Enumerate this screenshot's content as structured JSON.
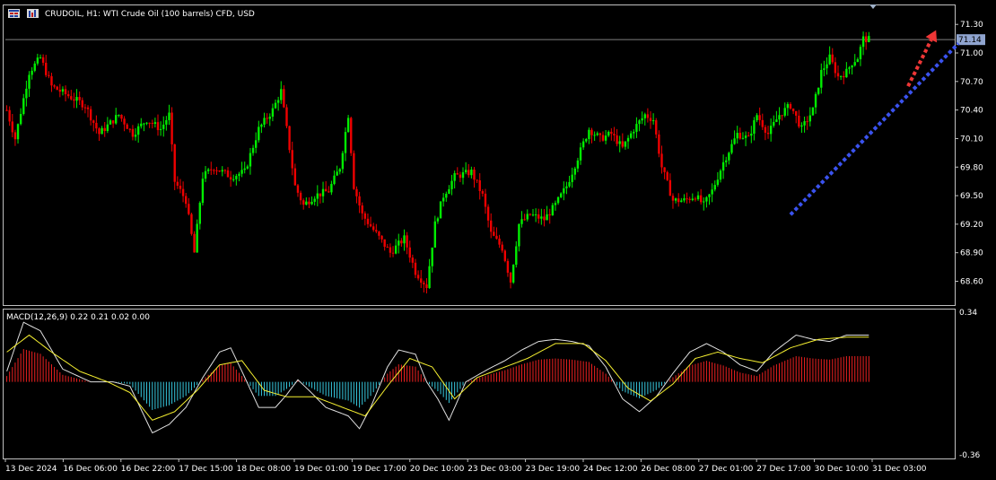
{
  "header": {
    "symbol_text": "CRUDOIL, H1:  WTI Crude Oil (100 barrels) CFD, USD"
  },
  "colors": {
    "background": "#000000",
    "frame": "#c0c0c0",
    "bull": "#00ee00",
    "bear": "#ee0000",
    "hist_pos": "#ee2020",
    "hist_neg": "#36c8de",
    "macd_line": "#e0e0e0",
    "signal_line": "#f5ef30",
    "trend_line": "#3a52ee",
    "arrow": "#ee3636",
    "bid_line": "#808080",
    "bid_tag": "#8fa4cf"
  },
  "price_axis": {
    "ticks": [
      "71.30",
      "71.00",
      "70.70",
      "70.40",
      "70.10",
      "69.80",
      "69.50",
      "69.20",
      "68.90",
      "68.60"
    ],
    "current_tag": "71.14",
    "range": [
      68.35,
      71.5
    ]
  },
  "macd_panel": {
    "label": "MACD(12,26,9) 0.22 0.21 0.02 0.00",
    "axis_top": "0.34",
    "axis_bottom": "-0.36",
    "range": [
      -0.36,
      0.34
    ]
  },
  "time_axis": {
    "labels": [
      "13 Dec 2024",
      "16 Dec 06:00",
      "16 Dec 22:00",
      "17 Dec 15:00",
      "18 Dec 08:00",
      "19 Dec 01:00",
      "19 Dec 17:00",
      "20 Dec 10:00",
      "23 Dec 03:00",
      "23 Dec 19:00",
      "24 Dec 12:00",
      "26 Dec 08:00",
      "27 Dec 01:00",
      "27 Dec 17:00",
      "30 Dec 10:00",
      "31 Dec 03:00"
    ]
  },
  "chart_data": {
    "type": "candlestick",
    "symbol": "CRUDOIL",
    "timeframe": "H1",
    "price_path": [
      [
        0,
        70.4
      ],
      [
        3,
        70.1
      ],
      [
        8,
        70.8
      ],
      [
        12,
        70.95
      ],
      [
        16,
        70.65
      ],
      [
        22,
        70.55
      ],
      [
        28,
        70.45
      ],
      [
        33,
        70.15
      ],
      [
        40,
        70.35
      ],
      [
        45,
        70.15
      ],
      [
        50,
        70.3
      ],
      [
        55,
        70.2
      ],
      [
        58,
        70.35
      ],
      [
        60,
        69.65
      ],
      [
        64,
        69.45
      ],
      [
        67,
        68.9
      ],
      [
        70,
        69.7
      ],
      [
        74,
        69.8
      ],
      [
        80,
        69.7
      ],
      [
        85,
        69.75
      ],
      [
        90,
        70.2
      ],
      [
        95,
        70.4
      ],
      [
        98,
        70.6
      ],
      [
        100,
        70.2
      ],
      [
        103,
        69.6
      ],
      [
        106,
        69.4
      ],
      [
        110,
        69.5
      ],
      [
        115,
        69.55
      ],
      [
        119,
        69.8
      ],
      [
        122,
        70.35
      ],
      [
        124,
        69.6
      ],
      [
        127,
        69.3
      ],
      [
        132,
        69.1
      ],
      [
        137,
        68.9
      ],
      [
        142,
        69.05
      ],
      [
        146,
        68.7
      ],
      [
        150,
        68.55
      ],
      [
        153,
        69.2
      ],
      [
        156,
        69.5
      ],
      [
        160,
        69.7
      ],
      [
        166,
        69.75
      ],
      [
        170,
        69.5
      ],
      [
        173,
        69.1
      ],
      [
        177,
        68.95
      ],
      [
        180,
        68.6
      ],
      [
        183,
        69.2
      ],
      [
        187,
        69.3
      ],
      [
        192,
        69.25
      ],
      [
        196,
        69.4
      ],
      [
        200,
        69.6
      ],
      [
        204,
        69.9
      ],
      [
        208,
        70.2
      ],
      [
        212,
        70.1
      ],
      [
        216,
        70.15
      ],
      [
        220,
        70.0
      ],
      [
        224,
        70.2
      ],
      [
        228,
        70.35
      ],
      [
        231,
        70.3
      ],
      [
        234,
        69.8
      ],
      [
        238,
        69.45
      ],
      [
        242,
        69.45
      ],
      [
        246,
        69.5
      ],
      [
        249,
        69.4
      ],
      [
        252,
        69.55
      ],
      [
        256,
        69.85
      ],
      [
        261,
        70.15
      ],
      [
        265,
        70.1
      ],
      [
        268,
        70.35
      ],
      [
        272,
        70.15
      ],
      [
        276,
        70.35
      ],
      [
        280,
        70.45
      ],
      [
        284,
        70.2
      ],
      [
        288,
        70.4
      ],
      [
        291,
        70.8
      ],
      [
        294,
        70.95
      ],
      [
        297,
        70.75
      ],
      [
        300,
        70.8
      ],
      [
        302,
        70.9
      ],
      [
        304,
        70.95
      ],
      [
        306,
        71.15
      ],
      [
        308,
        71.14
      ]
    ],
    "macd_path": [
      [
        0,
        0.05
      ],
      [
        6,
        0.28
      ],
      [
        12,
        0.24
      ],
      [
        20,
        0.06
      ],
      [
        30,
        0.0
      ],
      [
        38,
        0.0
      ],
      [
        44,
        -0.02
      ],
      [
        52,
        -0.24
      ],
      [
        58,
        -0.2
      ],
      [
        64,
        -0.12
      ],
      [
        70,
        0.02
      ],
      [
        76,
        0.14
      ],
      [
        80,
        0.16
      ],
      [
        84,
        0.05
      ],
      [
        90,
        -0.12
      ],
      [
        96,
        -0.12
      ],
      [
        100,
        -0.06
      ],
      [
        104,
        0.01
      ],
      [
        108,
        -0.04
      ],
      [
        114,
        -0.12
      ],
      [
        122,
        -0.16
      ],
      [
        126,
        -0.22
      ],
      [
        130,
        -0.12
      ],
      [
        136,
        0.07
      ],
      [
        140,
        0.15
      ],
      [
        146,
        0.13
      ],
      [
        150,
        0.0
      ],
      [
        154,
        -0.08
      ],
      [
        158,
        -0.18
      ],
      [
        164,
        0.0
      ],
      [
        172,
        0.06
      ],
      [
        178,
        0.1
      ],
      [
        184,
        0.15
      ],
      [
        190,
        0.19
      ],
      [
        196,
        0.2
      ],
      [
        202,
        0.19
      ],
      [
        208,
        0.17
      ],
      [
        214,
        0.07
      ],
      [
        220,
        -0.08
      ],
      [
        226,
        -0.14
      ],
      [
        232,
        -0.07
      ],
      [
        238,
        0.04
      ],
      [
        244,
        0.14
      ],
      [
        250,
        0.18
      ],
      [
        256,
        0.14
      ],
      [
        262,
        0.08
      ],
      [
        268,
        0.05
      ],
      [
        274,
        0.14
      ],
      [
        282,
        0.22
      ],
      [
        288,
        0.2
      ],
      [
        294,
        0.19
      ],
      [
        300,
        0.22
      ]
    ],
    "signal_path": [
      [
        0,
        0.14
      ],
      [
        8,
        0.22
      ],
      [
        16,
        0.14
      ],
      [
        26,
        0.05
      ],
      [
        36,
        0.0
      ],
      [
        44,
        -0.05
      ],
      [
        52,
        -0.18
      ],
      [
        60,
        -0.14
      ],
      [
        68,
        -0.04
      ],
      [
        76,
        0.08
      ],
      [
        84,
        0.1
      ],
      [
        92,
        -0.04
      ],
      [
        100,
        -0.07
      ],
      [
        110,
        -0.07
      ],
      [
        120,
        -0.12
      ],
      [
        128,
        -0.16
      ],
      [
        136,
        -0.02
      ],
      [
        144,
        0.11
      ],
      [
        152,
        0.07
      ],
      [
        160,
        -0.08
      ],
      [
        168,
        0.02
      ],
      [
        176,
        0.06
      ],
      [
        186,
        0.11
      ],
      [
        196,
        0.18
      ],
      [
        206,
        0.18
      ],
      [
        214,
        0.1
      ],
      [
        222,
        -0.03
      ],
      [
        230,
        -0.09
      ],
      [
        238,
        -0.01
      ],
      [
        246,
        0.11
      ],
      [
        254,
        0.14
      ],
      [
        262,
        0.11
      ],
      [
        270,
        0.09
      ],
      [
        280,
        0.16
      ],
      [
        290,
        0.2
      ],
      [
        300,
        0.21
      ]
    ],
    "trend_line": {
      "from": [
        280,
        69.3
      ],
      "to": [
        340,
        71.1
      ],
      "style": "dotted"
    },
    "projection_arrow": {
      "from": [
        322,
        70.65
      ],
      "to": [
        332,
        71.24
      ],
      "style": "dotted"
    },
    "current_price": 71.14
  }
}
